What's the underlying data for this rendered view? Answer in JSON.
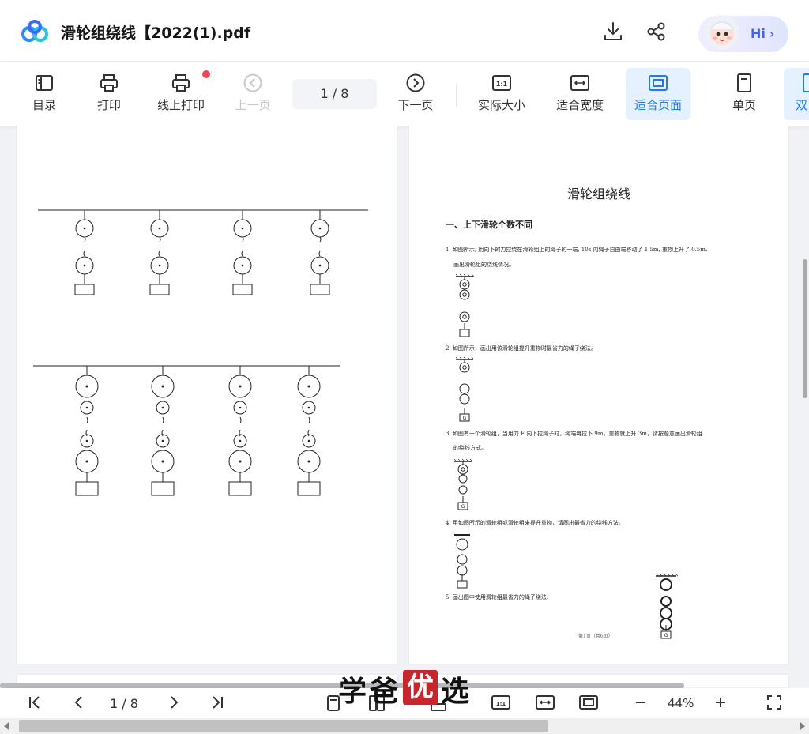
{
  "header": {
    "title": "滑轮组绕线【2022(1).pdf",
    "assistant_label": "Hi"
  },
  "toolbar": {
    "items": [
      {
        "label": "目录"
      },
      {
        "label": "打印"
      },
      {
        "label": "线上打印"
      },
      {
        "label": "上一页"
      },
      {
        "label": "下一页"
      },
      {
        "label": "实际大小"
      },
      {
        "label": "适合宽度"
      },
      {
        "label": "适合页面"
      },
      {
        "label": "单页"
      },
      {
        "label": "双"
      }
    ],
    "page_indicator": "1  / 8"
  },
  "document": {
    "title": "滑轮组绕线",
    "section1": "一、上下滑轮个数不同",
    "q1_line1": "1. 如图所示, 用向下的力拉绕在滑轮组上的绳子的一端, 10s 内绳子自由端移动了 1.5m, 重物上升了 0.5m,",
    "q1_line2": "画出滑轮组的绕线情况。",
    "q2": "2. 如图所示，画出用该滑轮组提升重物时最省力的绳子绕法。",
    "q3_line1": "3. 如图有一个滑轮组，当用力 F 向下拉绳子时，绳端每拉下 9m，重物就上升 3m，请按题意画出滑轮组",
    "q3_line2": "的绕线方式。",
    "q4": "4. 用如图所示的滑轮组或滑轮组来提升重物，请画出最省力的绕线方法。",
    "q5": "5. 画出图中使用滑轮组最省力的绳子绕法.",
    "weight_label": "G",
    "footer": "第1页（共6页）"
  },
  "bottombar": {
    "page": "1 / 8",
    "zoom": "44%"
  },
  "watermark": {
    "c1": "学",
    "c2": "爸",
    "c3": "优",
    "c4": "选"
  },
  "colors": {
    "accent": "#1f7bf2",
    "active_bg": "#e6f1ff",
    "notify": "#f0435a",
    "watermark_red": "#c8252c"
  }
}
